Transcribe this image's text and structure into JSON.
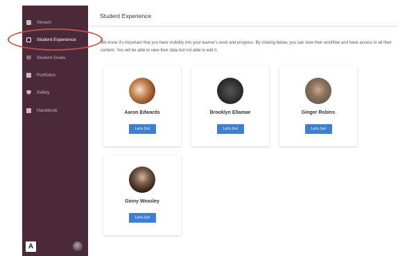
{
  "sidebar": {
    "items": [
      {
        "label": "Stream",
        "icon": "stream-icon"
      },
      {
        "label": "Student Experience",
        "icon": "student-experience-icon"
      },
      {
        "label": "Student Goals",
        "icon": "goals-icon"
      },
      {
        "label": "Portfolios",
        "icon": "portfolio-icon"
      },
      {
        "label": "Safety",
        "icon": "shield-icon"
      },
      {
        "label": "Handbook",
        "icon": "handbook-icon"
      }
    ],
    "logo_letter": "A",
    "colors": {
      "background": "#4a2a38",
      "active_text": "#ffffff",
      "text": "#c9b6be"
    }
  },
  "header": {
    "title": "Student Experience"
  },
  "intro": {
    "text": "We know it's important that you have visibility into your learner's work and progress. By clicking below, you can view their workflow and have access to all their content. You will be able to view their data but not able to edit it."
  },
  "students": [
    {
      "name": "Aaron Edwards",
      "button": "Let's Go!"
    },
    {
      "name": "Brooklyn Ellamae",
      "button": "Let's Go!"
    },
    {
      "name": "Ginger Robins",
      "button": "Let's Go!"
    },
    {
      "name": "Ginny Weasley",
      "button": "Let's Go!"
    }
  ],
  "colors": {
    "accent": "#3d7fd1",
    "highlight_oval": "#c0504d"
  }
}
